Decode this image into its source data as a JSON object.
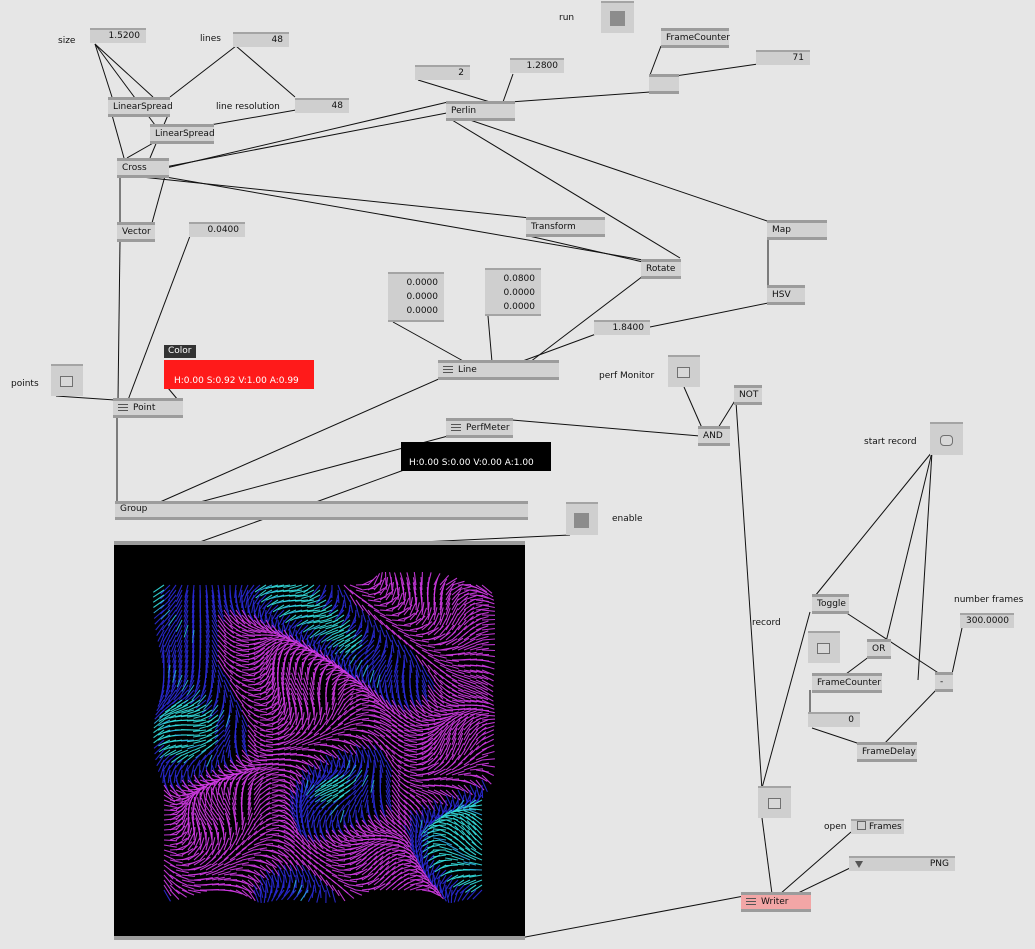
{
  "labels": {
    "size": "size",
    "lines": "lines",
    "line_resolution": "line resolution",
    "run": "run",
    "points": "points",
    "perf_monitor": "perf Monitor",
    "enable": "enable",
    "start_record": "start record",
    "number_frames": "number frames",
    "record": "record",
    "open": "open"
  },
  "values": {
    "size": "1.5200",
    "lines": "48",
    "line_resolution": "48",
    "perlin_in1": "2",
    "perlin_in2": "1.2800",
    "frame_count": "71",
    "point_size": "0.0400",
    "vec_a": [
      "0.0000",
      "0.0000",
      "0.0000"
    ],
    "vec_b": [
      "0.0800",
      "0.0000",
      "0.0000"
    ],
    "line_width": "1.8400",
    "number_frames": "300.0000",
    "counter_reset": "0"
  },
  "nodes": {
    "linearspread1": "LinearSpread",
    "linearspread2": "LinearSpread",
    "cross": "Cross",
    "vector": "Vector",
    "perlin": "Perlin",
    "framecounter_top": "FrameCounter",
    "transform": "Transform",
    "rotate": "Rotate",
    "map": "Map",
    "hsv": "HSV",
    "line": "Line",
    "point": "Point",
    "perfmeter": "PerfMeter",
    "not": "NOT",
    "and": "AND",
    "group": "Group",
    "toggle": "Toggle",
    "or": "OR",
    "framecounter_rec": "FrameCounter",
    "framedelay": "FrameDelay",
    "minus": "-",
    "writer": "Writer"
  },
  "color_node": {
    "title": "Color",
    "value": "H:0.00  S:0.92  V:1.00  A:0.99",
    "swatch": "#ff1a1a"
  },
  "perf_color": {
    "value": "H:0.00  S:0.00  V:0.00  A:1.00"
  },
  "writer_opts": {
    "frames": "Frames",
    "format": "PNG"
  },
  "colors": {
    "background": "#e6e6e6",
    "node_fill": "#d2d2d2",
    "writer_fill": "#f2a6a6",
    "render_bg": "#000000",
    "stroke_pink": "#d23be6",
    "stroke_blue": "#2a2ad8",
    "stroke_cyan": "#34e0e0"
  }
}
